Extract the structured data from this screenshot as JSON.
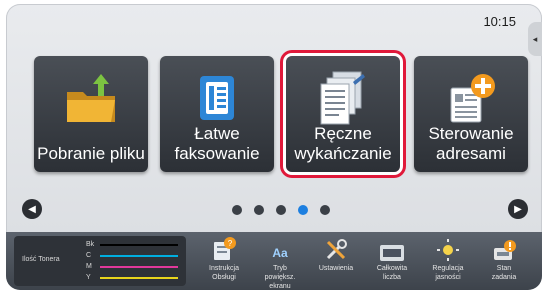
{
  "status": {
    "time": "10:15",
    "side_tab": "◂"
  },
  "tiles": [
    {
      "line1": "Pobranie pliku",
      "line2": ""
    },
    {
      "line1": "Łatwe",
      "line2": "faksowanie"
    },
    {
      "line1": "Ręczne",
      "line2": "wykańczanie"
    },
    {
      "line1": "Sterowanie",
      "line2": "adresami"
    }
  ],
  "pager": {
    "prev": "◀",
    "next": "▶",
    "pages": 5,
    "active_page": 4
  },
  "toner": {
    "label": "Ilość Tonera",
    "levels": [
      {
        "name": "Bk",
        "color": "#000000"
      },
      {
        "name": "C",
        "color": "#00aee0"
      },
      {
        "name": "M",
        "color": "#e2389b"
      },
      {
        "name": "Y",
        "color": "#e8d51c"
      }
    ]
  },
  "bottom": [
    {
      "l1": "Instrukcja",
      "l2": "Obsługi",
      "l3": ""
    },
    {
      "l1": "Tryb",
      "l2": "powiększ.",
      "l3": "ekranu"
    },
    {
      "l1": "Ustawienia",
      "l2": "",
      "l3": ""
    },
    {
      "l1": "Całkowita",
      "l2": "liczba",
      "l3": ""
    },
    {
      "l1": "Regulacja",
      "l2": "jasności",
      "l3": ""
    },
    {
      "l1": "Stan",
      "l2": "zadania",
      "l3": ""
    }
  ],
  "colors": {
    "accent_selected": "#e0193a",
    "active_dot": "#1d7fe0",
    "tile_bg": "#3a3f46"
  }
}
